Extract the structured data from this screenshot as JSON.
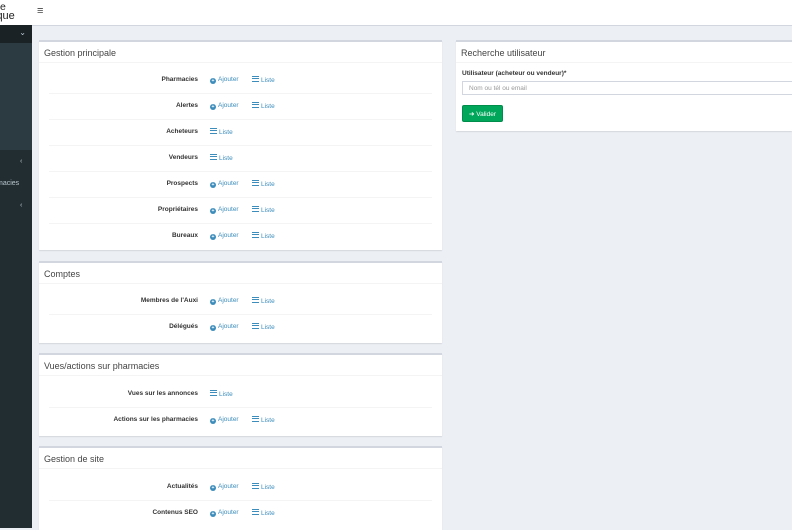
{
  "logo": {
    "line1": "e",
    "line2": "ique"
  },
  "sidebar": {
    "header_chevron": "⌄",
    "items": [
      {
        "label": "‹"
      },
      {
        "label": "macies"
      },
      {
        "label": "‹"
      }
    ]
  },
  "topbar": {
    "menu_glyph": "≡"
  },
  "links": {
    "add": "Ajouter",
    "list": "Liste"
  },
  "sections": [
    {
      "title": "Gestion principale",
      "rows": [
        {
          "label": "Pharmacies"
        },
        {
          "label": "Alertes"
        },
        {
          "label": "Acheteurs"
        },
        {
          "label": "Vendeurs"
        },
        {
          "label": "Prospects"
        },
        {
          "label": "Propriétaires"
        },
        {
          "label": "Bureaux"
        }
      ]
    },
    {
      "title": "Comptes",
      "rows": [
        {
          "label": "Membres de l'Auxi"
        },
        {
          "label": "Délégués"
        }
      ]
    },
    {
      "title": "Vues/actions sur pharmacies",
      "rows": [
        {
          "label": "Vues sur les annonces"
        },
        {
          "label": "Actions sur les pharmacies"
        }
      ]
    },
    {
      "title": "Gestion de site",
      "rows": [
        {
          "label": "Actualités"
        },
        {
          "label": "Contenus SEO"
        }
      ]
    }
  ],
  "search": {
    "title": "Recherche utilisateur",
    "field_label": "Utilisateur (acheteur ou vendeur)*",
    "placeholder": "Nom ou tél ou email",
    "submit_label": "Valider"
  }
}
